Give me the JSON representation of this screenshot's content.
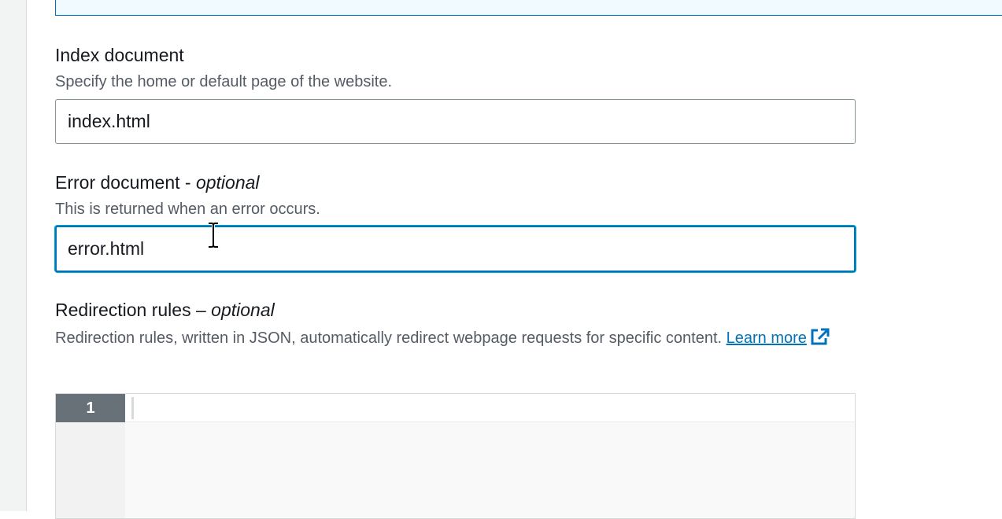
{
  "index_document": {
    "label": "Index document",
    "description": "Specify the home or default page of the website.",
    "value": "index.html"
  },
  "error_document": {
    "label": "Error document - ",
    "optional": "optional",
    "description": "This is returned when an error occurs.",
    "value": "error.html"
  },
  "redirection_rules": {
    "label": "Redirection rules – ",
    "optional": "optional",
    "description": "Redirection rules, written in JSON, automatically redirect webpage requests for specific content. ",
    "learn_more": "Learn more",
    "editor_line_number": "1",
    "editor_content": ""
  },
  "colors": {
    "accent": "#0073bb",
    "text": "#16191f",
    "muted": "#545b64"
  },
  "icons": {
    "external_link": "external-link-icon",
    "cursor": "text-cursor-icon"
  }
}
